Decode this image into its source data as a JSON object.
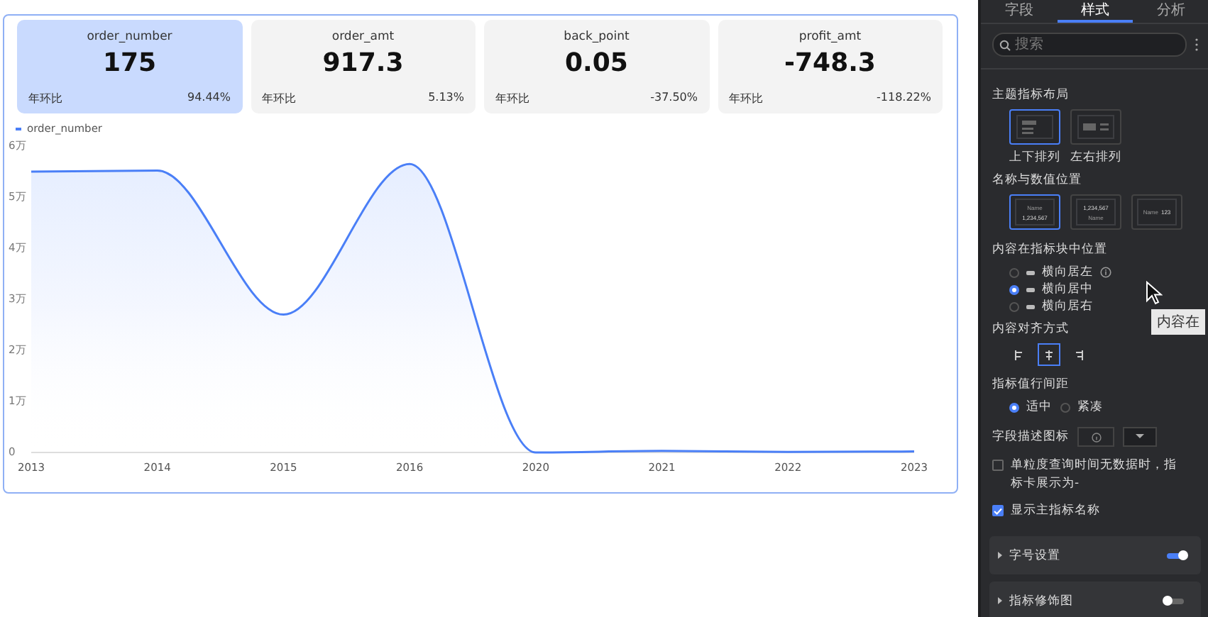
{
  "cards": [
    {
      "name": "order_number",
      "value": "175",
      "compare_label": "年环比",
      "compare_value": "94.44%",
      "selected": true
    },
    {
      "name": "order_amt",
      "value": "917.3",
      "compare_label": "年环比",
      "compare_value": "5.13%",
      "selected": false
    },
    {
      "name": "back_point",
      "value": "0.05",
      "compare_label": "年环比",
      "compare_value": "-37.50%",
      "selected": false
    },
    {
      "name": "profit_amt",
      "value": "-748.3",
      "compare_label": "年环比",
      "compare_value": "-118.22%",
      "selected": false
    }
  ],
  "chart": {
    "chart_data": {
      "type": "line",
      "categories": [
        "2013",
        "2014",
        "2015",
        "2016",
        "2020",
        "2021",
        "2022",
        "2023"
      ],
      "series": [
        {
          "name": "order_number",
          "color": "#4a7ff7",
          "values": [
            5.5,
            5.52,
            2.7,
            5.65,
            0,
            0.03,
            0.01,
            0.02
          ]
        }
      ],
      "ylim": [
        0,
        6
      ],
      "yticks": [
        {
          "value": 0,
          "label": "0"
        },
        {
          "value": 1,
          "label": "1万"
        },
        {
          "value": 2,
          "label": "2万"
        },
        {
          "value": 3,
          "label": "3万"
        },
        {
          "value": 4,
          "label": "4万"
        },
        {
          "value": 5,
          "label": "5万"
        },
        {
          "value": 6,
          "label": "6万"
        }
      ]
    }
  },
  "panel": {
    "tabs": [
      {
        "label": "字段",
        "selected": false
      },
      {
        "label": "样式",
        "selected": true
      },
      {
        "label": "分析",
        "selected": false
      }
    ],
    "search": {
      "placeholder": "搜索"
    },
    "layout": {
      "title": "主题指标布局",
      "options": [
        {
          "kind": "vertical",
          "label": "上下排列",
          "selected": true
        },
        {
          "kind": "horizontal",
          "label": "左右排列",
          "selected": false
        }
      ]
    },
    "name_value_position": {
      "title": "名称与数值位置",
      "options": [
        {
          "kind": "name_top",
          "name": "Name",
          "value": "1,234,567",
          "selected": true
        },
        {
          "kind": "value_top",
          "name": "Name",
          "value": "1,234,567",
          "selected": false
        },
        {
          "kind": "inline",
          "name": "Name",
          "value": "123",
          "selected": false
        }
      ]
    },
    "content_position": {
      "title": "内容在指标块中位置",
      "options": [
        {
          "label": "横向居左",
          "selected": false,
          "info": true
        },
        {
          "label": "横向居中",
          "selected": true,
          "info": false
        },
        {
          "label": "横向居右",
          "selected": false,
          "info": false
        }
      ]
    },
    "content_align": {
      "title": "内容对齐方式",
      "options": [
        {
          "kind": "left",
          "selected": false
        },
        {
          "kind": "center",
          "selected": true
        },
        {
          "kind": "right",
          "selected": false
        }
      ]
    },
    "line_spacing": {
      "title": "指标值行间距",
      "options": [
        {
          "label": "适中",
          "selected": true
        },
        {
          "label": "紧凑",
          "selected": false
        }
      ]
    },
    "field_icon": {
      "label": "字段描述图标"
    },
    "checkboxes": [
      {
        "label": "单粒度查询时间无数据时，指标卡展示为-",
        "checked": false
      },
      {
        "label": "显示主指标名称",
        "checked": true
      }
    ],
    "sections": [
      {
        "title": "字号设置",
        "on": true
      },
      {
        "title": "指标修饰图",
        "on": false
      }
    ],
    "tooltip": "内容在"
  }
}
